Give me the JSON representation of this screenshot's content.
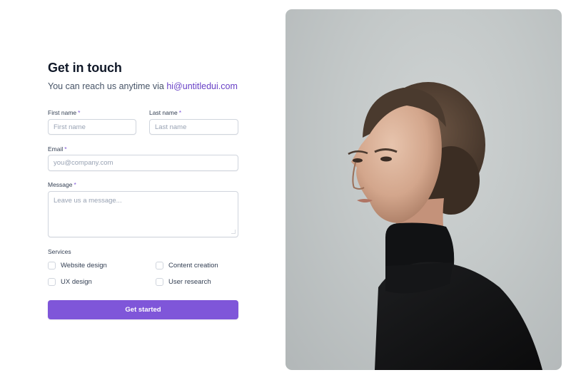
{
  "header": {
    "title": "Get in touch",
    "subtitle_prefix": "You can reach us anytime via",
    "email_link": "hi@untitledui.com"
  },
  "form": {
    "first_name": {
      "label": "First name",
      "required_mark": "*",
      "placeholder": "First name",
      "value": ""
    },
    "last_name": {
      "label": "Last name",
      "required_mark": "*",
      "placeholder": "Last name",
      "value": ""
    },
    "email": {
      "label": "Email",
      "required_mark": "*",
      "placeholder": "you@company.com",
      "value": ""
    },
    "message": {
      "label": "Message",
      "required_mark": "*",
      "placeholder": "Leave us a message...",
      "value": ""
    },
    "services": {
      "label": "Services",
      "options": [
        {
          "label": "Website design",
          "checked": false
        },
        {
          "label": "Content creation",
          "checked": false
        },
        {
          "label": "UX design",
          "checked": false
        },
        {
          "label": "User research",
          "checked": false
        }
      ]
    },
    "submit_label": "Get started"
  },
  "colors": {
    "accent": "#7f56d9",
    "link": "#6941c6",
    "text": "#101828",
    "muted": "#475467",
    "border": "#d0d5dd"
  }
}
